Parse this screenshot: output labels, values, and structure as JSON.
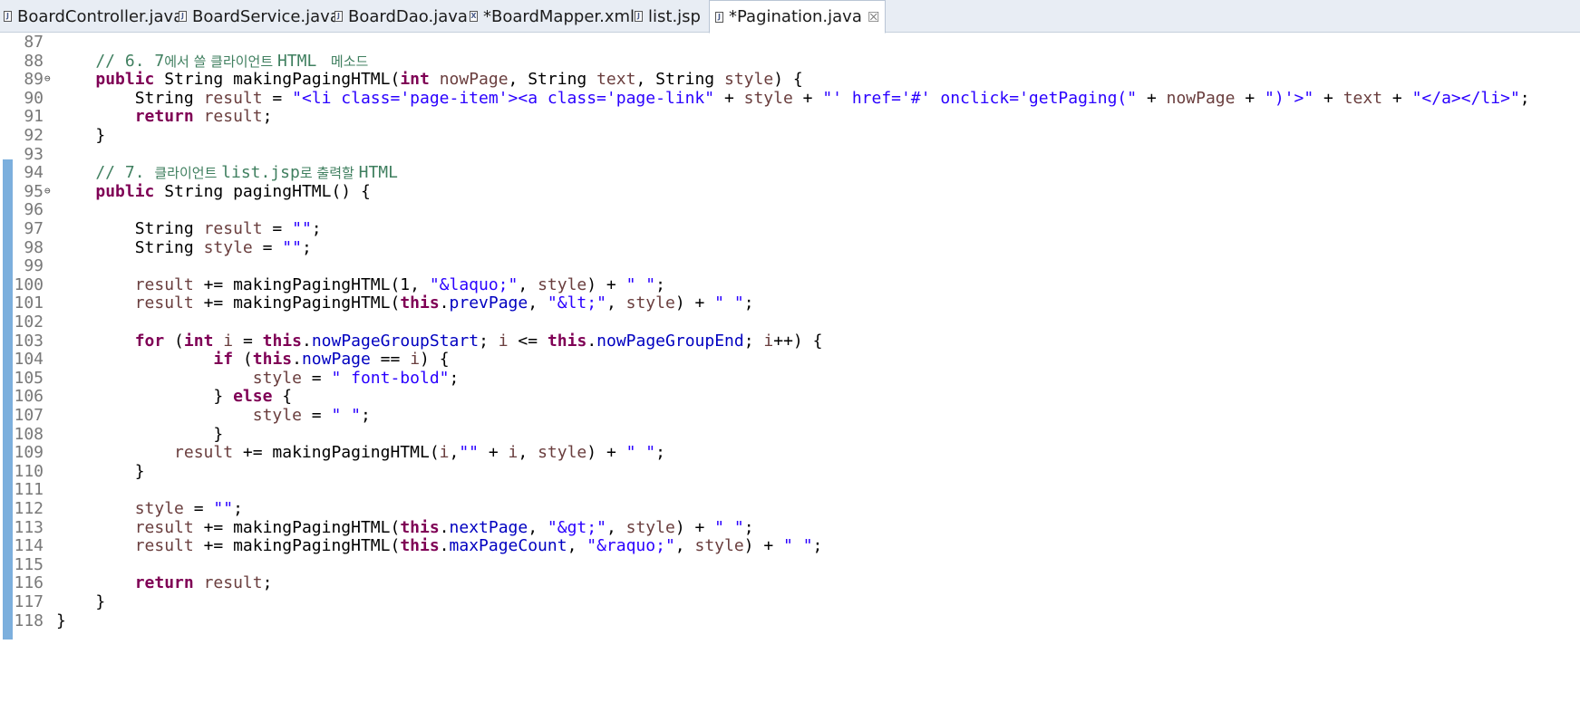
{
  "tabs": [
    {
      "label": "BoardController.java",
      "icon": "java-file-icon",
      "glyph": "J"
    },
    {
      "label": "BoardService.java",
      "icon": "java-file-icon",
      "glyph": "J"
    },
    {
      "label": "BoardDao.java",
      "icon": "java-file-icon",
      "glyph": "J"
    },
    {
      "label": "*BoardMapper.xml",
      "icon": "xml-file-icon",
      "glyph": "X"
    },
    {
      "label": "list.jsp",
      "icon": "jsp-file-icon",
      "glyph": "J"
    },
    {
      "label": "*Pagination.java",
      "icon": "java-file-icon",
      "glyph": "J",
      "active": true,
      "close": "☒"
    }
  ],
  "lines": [
    {
      "n": "87",
      "t": []
    },
    {
      "n": "88",
      "t": [
        [
          "cmt",
          "    // 6. 7"
        ],
        [
          "cmt kor",
          "에서 쓸 클라이언트 "
        ],
        [
          "cmt",
          "HTML "
        ],
        [
          "cmt kor",
          " 메소드"
        ]
      ]
    },
    {
      "n": "89",
      "fold": "⊖",
      "t": [
        [
          "",
          "    "
        ],
        [
          "kw",
          "public"
        ],
        [
          "",
          " String makingPagingHTML("
        ],
        [
          "kw",
          "int"
        ],
        [
          "",
          " "
        ],
        [
          "var",
          "nowPage"
        ],
        [
          "",
          ", String "
        ],
        [
          "var",
          "text"
        ],
        [
          "",
          ", String "
        ],
        [
          "var",
          "style"
        ],
        [
          "",
          ") {"
        ]
      ]
    },
    {
      "n": "90",
      "t": [
        [
          "",
          "        String "
        ],
        [
          "var",
          "result"
        ],
        [
          "",
          " = "
        ],
        [
          "str",
          "\"<li class='page-item'><a class='page-link\""
        ],
        [
          "",
          " + "
        ],
        [
          "var",
          "style"
        ],
        [
          "",
          " + "
        ],
        [
          "str",
          "\"' href='#' onclick='getPaging(\""
        ],
        [
          "",
          " + "
        ],
        [
          "var",
          "nowPage"
        ],
        [
          "",
          " + "
        ],
        [
          "str",
          "\")'>\""
        ],
        [
          "",
          " + "
        ],
        [
          "var",
          "text"
        ],
        [
          "",
          " + "
        ],
        [
          "str",
          "\"</a></li>\""
        ],
        [
          "",
          ";"
        ]
      ]
    },
    {
      "n": "91",
      "t": [
        [
          "",
          "        "
        ],
        [
          "kw",
          "return"
        ],
        [
          "",
          " "
        ],
        [
          "var",
          "result"
        ],
        [
          "",
          ";"
        ]
      ]
    },
    {
      "n": "92",
      "t": [
        [
          "",
          "    }"
        ]
      ]
    },
    {
      "n": "93",
      "t": []
    },
    {
      "n": "94",
      "t": [
        [
          "cmt",
          "    // 7. "
        ],
        [
          "cmt kor",
          "클라이언트 "
        ],
        [
          "cmt",
          "list.jsp"
        ],
        [
          "cmt kor",
          "로 출력할 "
        ],
        [
          "cmt",
          "HTML"
        ]
      ]
    },
    {
      "n": "95",
      "fold": "⊖",
      "t": [
        [
          "",
          "    "
        ],
        [
          "kw",
          "public"
        ],
        [
          "",
          " String pagingHTML() {"
        ]
      ]
    },
    {
      "n": "96",
      "t": []
    },
    {
      "n": "97",
      "t": [
        [
          "",
          "        String "
        ],
        [
          "var",
          "result"
        ],
        [
          "",
          " = "
        ],
        [
          "str",
          "\"\""
        ],
        [
          "",
          ";"
        ]
      ]
    },
    {
      "n": "98",
      "t": [
        [
          "",
          "        String "
        ],
        [
          "var",
          "style"
        ],
        [
          "",
          " = "
        ],
        [
          "str",
          "\"\""
        ],
        [
          "",
          ";"
        ]
      ]
    },
    {
      "n": "99",
      "t": []
    },
    {
      "n": "100",
      "t": [
        [
          "",
          "        "
        ],
        [
          "var",
          "result"
        ],
        [
          "",
          " += makingPagingHTML(1, "
        ],
        [
          "str",
          "\"&laquo;\""
        ],
        [
          "",
          ", "
        ],
        [
          "var",
          "style"
        ],
        [
          "",
          ") + "
        ],
        [
          "str",
          "\" \""
        ],
        [
          "",
          ";"
        ]
      ]
    },
    {
      "n": "101",
      "t": [
        [
          "",
          "        "
        ],
        [
          "var",
          "result"
        ],
        [
          "",
          " += makingPagingHTML("
        ],
        [
          "kw",
          "this"
        ],
        [
          "",
          "."
        ],
        [
          "fld",
          "prevPage"
        ],
        [
          "",
          ", "
        ],
        [
          "str",
          "\"&lt;\""
        ],
        [
          "",
          ", "
        ],
        [
          "var",
          "style"
        ],
        [
          "",
          ") + "
        ],
        [
          "str",
          "\" \""
        ],
        [
          "",
          ";"
        ]
      ]
    },
    {
      "n": "102",
      "t": []
    },
    {
      "n": "103",
      "t": [
        [
          "",
          "        "
        ],
        [
          "kw",
          "for"
        ],
        [
          "",
          " ("
        ],
        [
          "kw",
          "int"
        ],
        [
          "",
          " "
        ],
        [
          "var",
          "i"
        ],
        [
          "",
          " = "
        ],
        [
          "kw",
          "this"
        ],
        [
          "",
          "."
        ],
        [
          "fld",
          "nowPageGroupStart"
        ],
        [
          "",
          "; "
        ],
        [
          "var",
          "i"
        ],
        [
          "",
          " <= "
        ],
        [
          "kw",
          "this"
        ],
        [
          "",
          "."
        ],
        [
          "fld",
          "nowPageGroupEnd"
        ],
        [
          "",
          "; "
        ],
        [
          "var",
          "i"
        ],
        [
          "",
          "++) {"
        ]
      ]
    },
    {
      "n": "104",
      "t": [
        [
          "",
          "                "
        ],
        [
          "kw",
          "if"
        ],
        [
          "",
          " ("
        ],
        [
          "kw",
          "this"
        ],
        [
          "",
          "."
        ],
        [
          "fld",
          "nowPage"
        ],
        [
          "",
          " == "
        ],
        [
          "var",
          "i"
        ],
        [
          "",
          ") {"
        ]
      ]
    },
    {
      "n": "105",
      "t": [
        [
          "",
          "                    "
        ],
        [
          "var",
          "style"
        ],
        [
          "",
          " = "
        ],
        [
          "str",
          "\" font-bold\""
        ],
        [
          "",
          ";"
        ]
      ]
    },
    {
      "n": "106",
      "t": [
        [
          "",
          "                } "
        ],
        [
          "kw",
          "else"
        ],
        [
          "",
          " {"
        ]
      ]
    },
    {
      "n": "107",
      "t": [
        [
          "",
          "                    "
        ],
        [
          "var",
          "style"
        ],
        [
          "",
          " = "
        ],
        [
          "str",
          "\" \""
        ],
        [
          "",
          ";"
        ]
      ]
    },
    {
      "n": "108",
      "t": [
        [
          "",
          "                }"
        ]
      ]
    },
    {
      "n": "109",
      "t": [
        [
          "",
          "            "
        ],
        [
          "var",
          "result"
        ],
        [
          "",
          " += makingPagingHTML("
        ],
        [
          "var",
          "i"
        ],
        [
          "",
          ","
        ],
        [
          "str",
          "\"\""
        ],
        [
          "",
          " + "
        ],
        [
          "var",
          "i"
        ],
        [
          "",
          ", "
        ],
        [
          "var",
          "style"
        ],
        [
          "",
          ") + "
        ],
        [
          "str",
          "\" \""
        ],
        [
          "",
          ";"
        ]
      ]
    },
    {
      "n": "110",
      "t": [
        [
          "",
          "        }"
        ]
      ]
    },
    {
      "n": "111",
      "t": []
    },
    {
      "n": "112",
      "t": [
        [
          "",
          "        "
        ],
        [
          "var",
          "style"
        ],
        [
          "",
          " = "
        ],
        [
          "str",
          "\"\""
        ],
        [
          "",
          ";"
        ]
      ]
    },
    {
      "n": "113",
      "t": [
        [
          "",
          "        "
        ],
        [
          "var",
          "result"
        ],
        [
          "",
          " += makingPagingHTML("
        ],
        [
          "kw",
          "this"
        ],
        [
          "",
          "."
        ],
        [
          "fld",
          "nextPage"
        ],
        [
          "",
          ", "
        ],
        [
          "str",
          "\"&gt;\""
        ],
        [
          "",
          ", "
        ],
        [
          "var",
          "style"
        ],
        [
          "",
          ") + "
        ],
        [
          "str",
          "\" \""
        ],
        [
          "",
          ";"
        ]
      ]
    },
    {
      "n": "114",
      "t": [
        [
          "",
          "        "
        ],
        [
          "var",
          "result"
        ],
        [
          "",
          " += makingPagingHTML("
        ],
        [
          "kw",
          "this"
        ],
        [
          "",
          "."
        ],
        [
          "fld",
          "maxPageCount"
        ],
        [
          "",
          ", "
        ],
        [
          "str",
          "\"&raquo;\""
        ],
        [
          "",
          ", "
        ],
        [
          "var",
          "style"
        ],
        [
          "",
          ") + "
        ],
        [
          "str",
          "\" \""
        ],
        [
          "",
          ";"
        ]
      ]
    },
    {
      "n": "115",
      "t": []
    },
    {
      "n": "116",
      "t": [
        [
          "",
          "        "
        ],
        [
          "kw",
          "return"
        ],
        [
          "",
          " "
        ],
        [
          "var",
          "result"
        ],
        [
          "",
          ";"
        ]
      ]
    },
    {
      "n": "117",
      "t": [
        [
          "",
          "    }"
        ]
      ]
    },
    {
      "n": "118",
      "t": [
        [
          "",
          "}"
        ]
      ]
    }
  ]
}
